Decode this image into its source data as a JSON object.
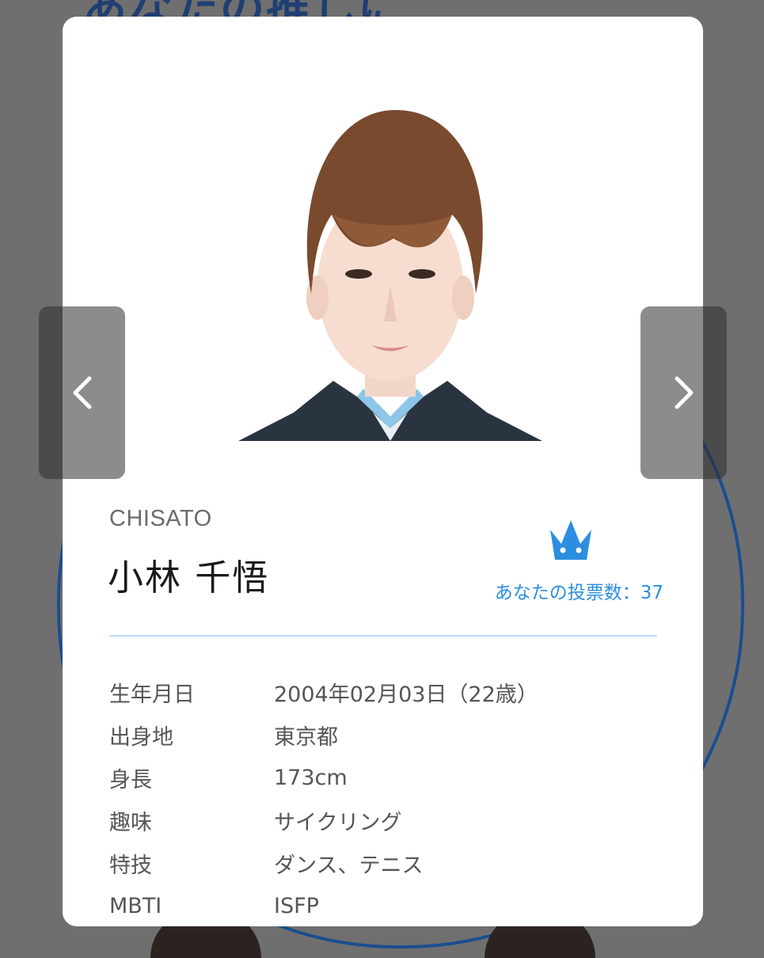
{
  "background": {
    "title_visible": "あなたの推しに"
  },
  "modal": {
    "member": {
      "romaji": "CHISATO",
      "name": "小林 千悟"
    },
    "votes": {
      "label": "あなたの投票数：37"
    },
    "profile": [
      {
        "key": "生年月日",
        "value": "2004年02月03日（22歳）"
      },
      {
        "key": "出身地",
        "value": "東京都"
      },
      {
        "key": "身長",
        "value": "173cm"
      },
      {
        "key": "趣味",
        "value": "サイクリング"
      },
      {
        "key": "特技",
        "value": "ダンス、テニス"
      },
      {
        "key": "MBTI",
        "value": "ISFP"
      }
    ]
  },
  "icons": {
    "prev": "chevron-left-icon",
    "next": "chevron-right-icon",
    "crown": "crown-icon"
  },
  "colors": {
    "accent": "#2b8ee0",
    "divider": "#bcdcf7",
    "overlay": "#6f6f6f"
  }
}
